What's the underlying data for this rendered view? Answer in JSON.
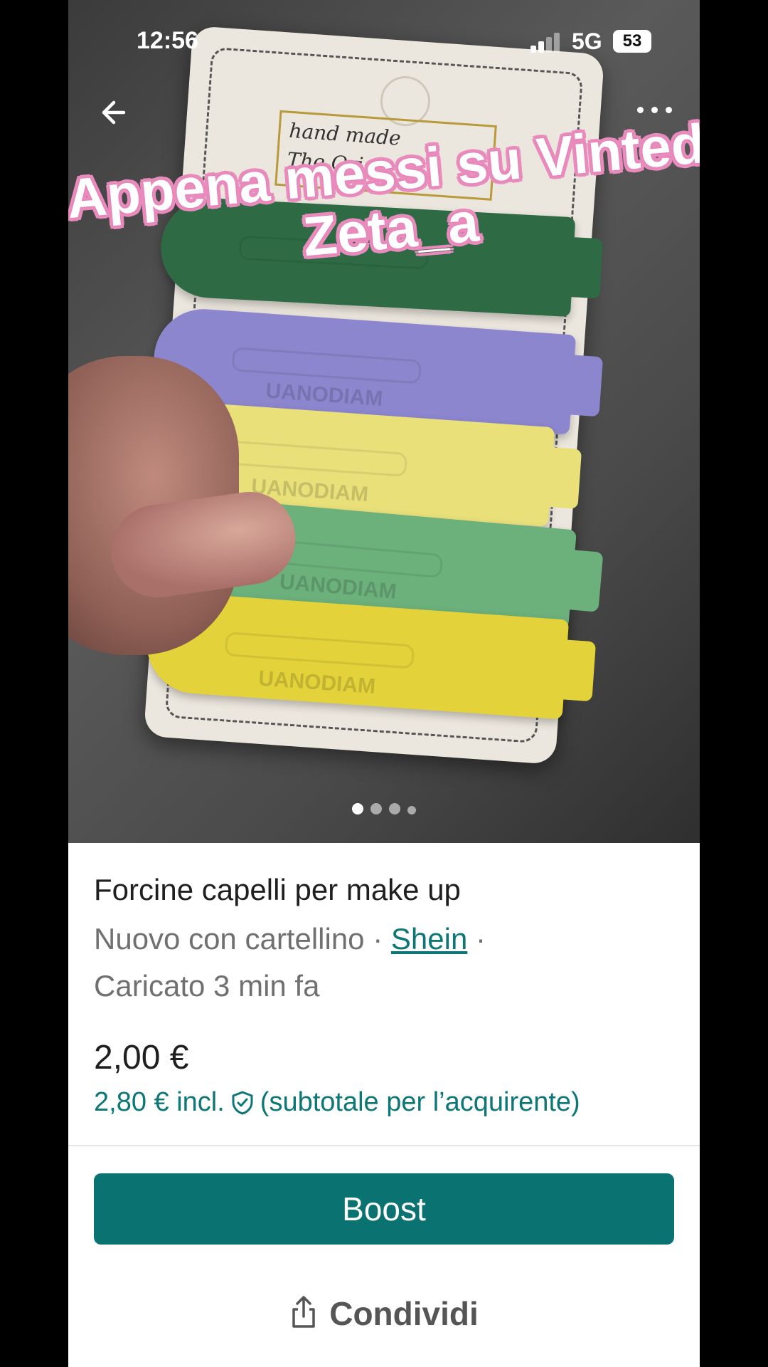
{
  "status_bar": {
    "time": "12:56",
    "network": "5G",
    "battery": "53"
  },
  "overlay_text": {
    "line1": "Appena messi su Vinted",
    "line2": "Zeta_a"
  },
  "photo": {
    "card_text_line1": "hand made",
    "card_text_line2": "The Original",
    "clip_brand": "UANODIAM",
    "image_count": 4,
    "current_image": 1
  },
  "item": {
    "title": "Forcine capelli per make up",
    "condition": "Nuovo con cartellino",
    "separator": "·",
    "brand": "Shein",
    "uploaded": "Caricato 3 min fa",
    "price": "2,00 €",
    "buyer_price": "2,80 € incl.",
    "buyer_note": "(subtotale per l’acquirente)"
  },
  "actions": {
    "boost_label": "Boost",
    "share_label": "Condividi"
  },
  "colors": {
    "accent": "#0a7372",
    "link": "#0d7676",
    "overlay_stroke": "#e98bbd"
  },
  "icons": {
    "back": "arrow-left-icon",
    "more": "more-horizontal-icon",
    "shield": "shield-check-icon",
    "share": "share-icon"
  }
}
